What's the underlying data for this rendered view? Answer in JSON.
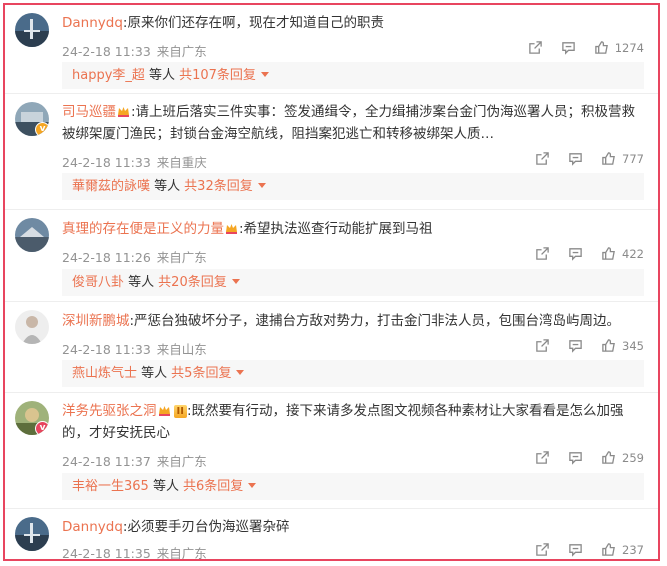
{
  "comments": [
    {
      "user": "Dannydq",
      "text": ":原来你们还存在啊，现在才知道自己的职责",
      "date": "24-2-18 11:33",
      "location": "来自广东",
      "likes": "1274",
      "reply_user": "happy李_超",
      "reply_mid": "等人",
      "reply_count": "共107条回复"
    },
    {
      "user": "司马巡疆",
      "text": ":请上班后落实三件实事：签发通缉令，全力缉捕涉案台金门伪海巡署人员；积极营救被绑架厦门渔民；封锁台金海空航线，阻挡案犯逃亡和转移被绑架人质…",
      "date": "24-2-18 11:33",
      "location": "来自重庆",
      "likes": "777",
      "reply_user": "華爾茲的詠嘆",
      "reply_mid": "等人",
      "reply_count": "共32条回复"
    },
    {
      "user": "真理的存在便是正义的力量",
      "text": ":希望执法巡查行动能扩展到马祖",
      "date": "24-2-18 11:26",
      "location": "来自广东",
      "likes": "422",
      "reply_user": "俊哥八卦",
      "reply_mid": "等人",
      "reply_count": "共20条回复"
    },
    {
      "user": "深圳新鹏城",
      "text": ":严惩台独破坏分子，逮捕台方敌对势力，打击金门非法人员，包围台湾岛屿周边。",
      "date": "24-2-18 11:33",
      "location": "来自山东",
      "likes": "345",
      "reply_user": "燕山炼气士",
      "reply_mid": "等人",
      "reply_count": "共5条回复"
    },
    {
      "user": "洋务先驱张之洞",
      "vip": "II",
      "text": ":既然要有行动，接下来请多发点图文视频各种素材让大家看看是怎么加强的，才好安抚民心",
      "date": "24-2-18 11:37",
      "location": "来自广东",
      "likes": "259",
      "reply_user": "丰裕一生365",
      "reply_mid": "等人",
      "reply_count": "共6条回复"
    },
    {
      "user": "Dannydq",
      "text": ":必须要手刃台伪海巡署杂碎",
      "date": "24-2-18 11:35",
      "location": "来自广东",
      "likes": "237"
    }
  ],
  "colors": {
    "accent": "#eb7350",
    "frame": "#e8455f"
  }
}
